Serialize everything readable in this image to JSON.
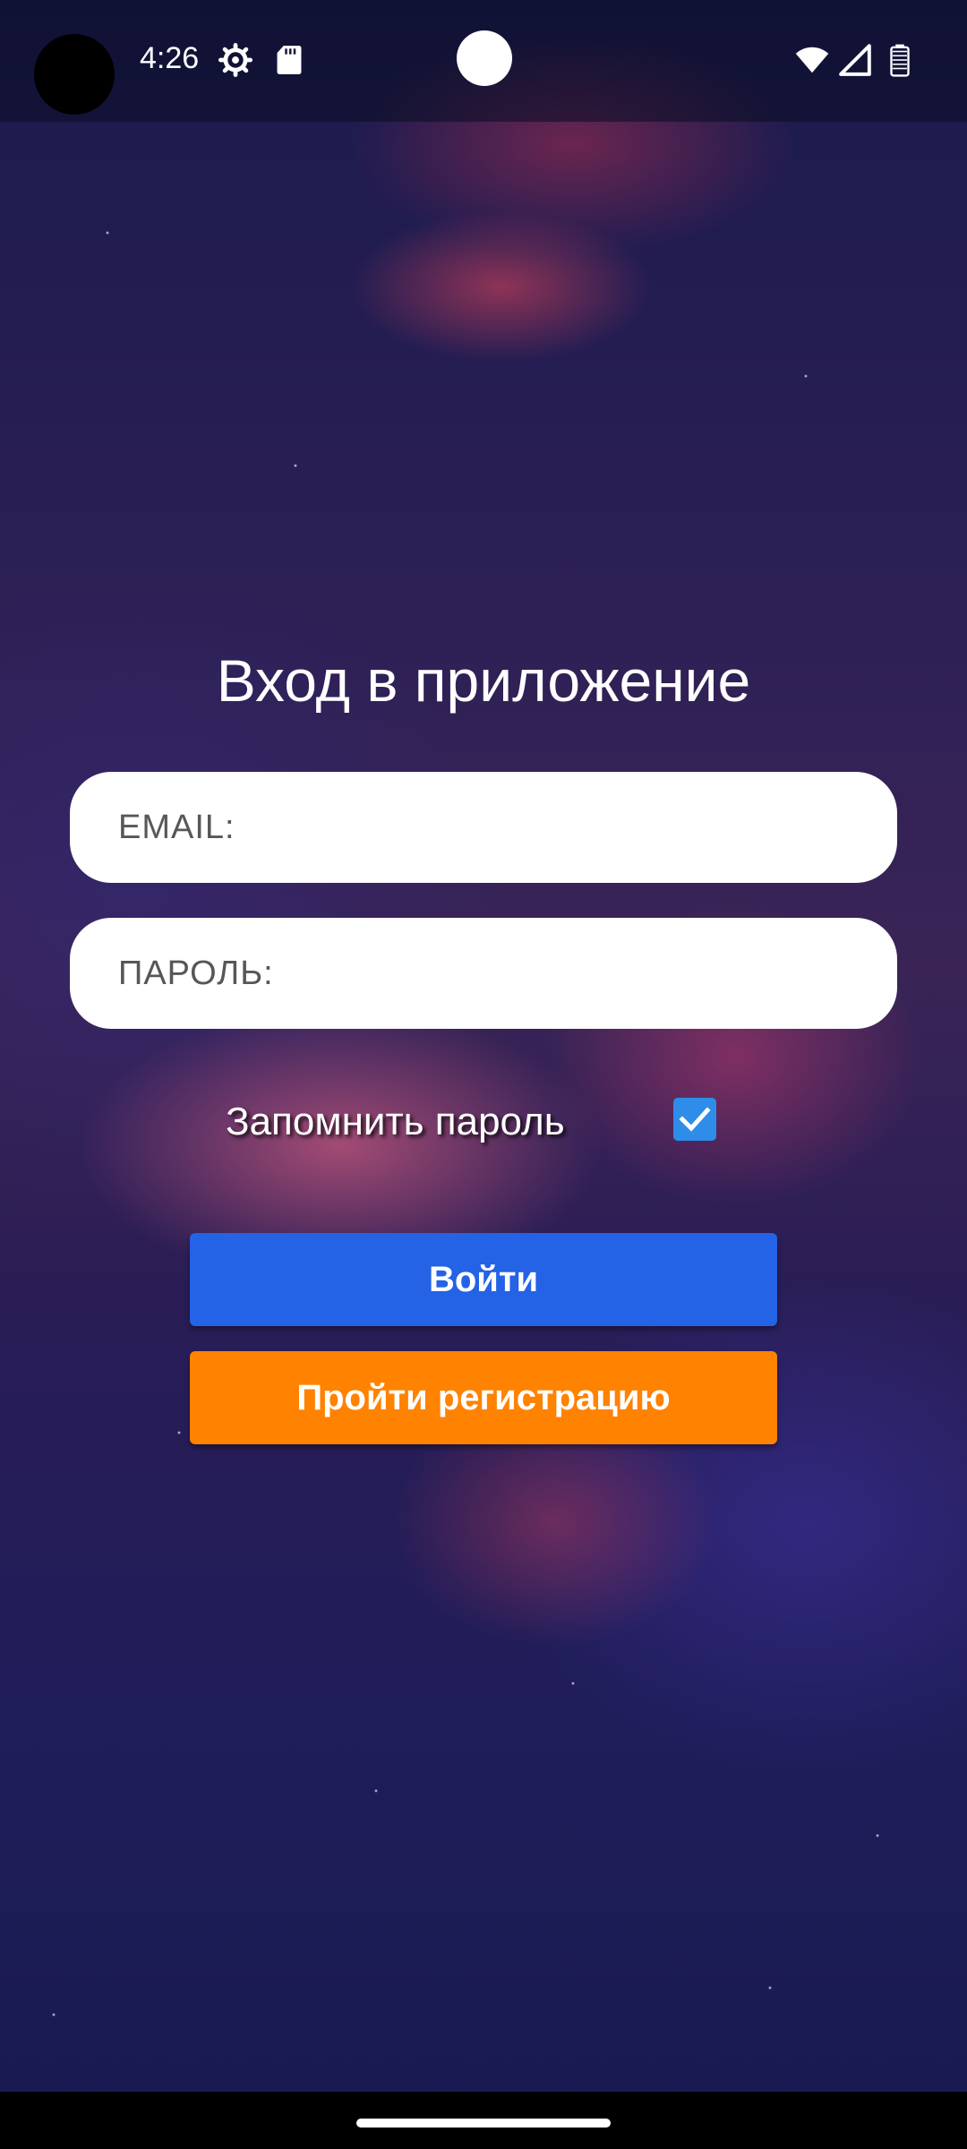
{
  "status_bar": {
    "time": "4:26",
    "icons": [
      "settings-icon",
      "sd-card-icon",
      "wifi-icon",
      "signal-icon",
      "battery-icon"
    ]
  },
  "login": {
    "title": "Вход в приложение",
    "email_placeholder": "EMAIL:",
    "password_placeholder": "ПАРОЛЬ:",
    "remember_label": "Запомнить пароль",
    "remember_checked": true,
    "login_button": "Войти",
    "register_button": "Пройти регистрацию"
  },
  "colors": {
    "login_button": "#2462e6",
    "register_button": "#ff8200",
    "checkbox": "#2e8de8"
  }
}
